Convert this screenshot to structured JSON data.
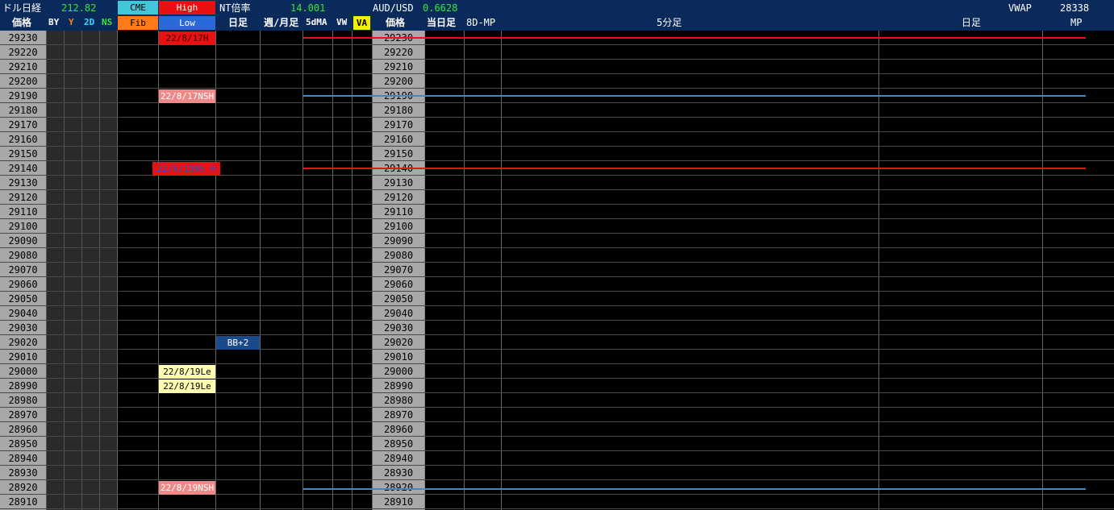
{
  "header": {
    "dollar_nikkei_label": "ドル日経",
    "dollar_nikkei_value": "212.82",
    "cme_label": "CME",
    "high_label": "High",
    "nt_label": "NT倍率",
    "nt_value": "14.001",
    "audusd_label": "AUD/USD",
    "audusd_value": "0.6628",
    "vwap_label": "VWAP",
    "vwap_value": "28338",
    "price_left": "価格",
    "by": "BY",
    "y": "Y",
    "two_d": "2D",
    "ns": "NS",
    "fib": "Fib",
    "low": "Low",
    "daily": "日足",
    "week_month": "週/月足",
    "five_dma": "5dMA",
    "vw": "VW",
    "va": "VA",
    "price_right": "価格",
    "today_daily": "当日足",
    "eight_d_mp": "8D-MP",
    "five_min": "5分足",
    "daily_right": "日足",
    "mp": "MP"
  },
  "prices": [
    "29230",
    "29220",
    "29210",
    "29200",
    "29190",
    "29180",
    "29170",
    "29160",
    "29150",
    "29140",
    "29130",
    "29120",
    "29110",
    "29100",
    "29090",
    "29080",
    "29070",
    "29060",
    "29050",
    "29040",
    "29030",
    "29020",
    "29010",
    "29000",
    "28990",
    "28980",
    "28970",
    "28960",
    "28950",
    "28940",
    "28930",
    "28920",
    "28910"
  ],
  "high_low_labels": {
    "r0": "22/8/17H",
    "r4": "22/8/17NSH",
    "r9": "22/8/19NS_H",
    "r23": "22/8/19Le",
    "r24": "22/8/19Le",
    "r31": "22/8/19NSH"
  },
  "bb_label": "BB+2",
  "colors": {
    "header_bg": "#0a2a5c",
    "price_col_bg": "#a8a8a8",
    "cme_bg": "#40c8d8",
    "fib_bg": "#ff7a18",
    "high_bg": "#e81010",
    "low_bg": "#2a6ad8",
    "va_bg": "#f0f000",
    "pink_label": "#f08888",
    "yellow_label": "#ffffb0",
    "red_line": "#e01818",
    "blue_line": "#3a8ad0"
  }
}
